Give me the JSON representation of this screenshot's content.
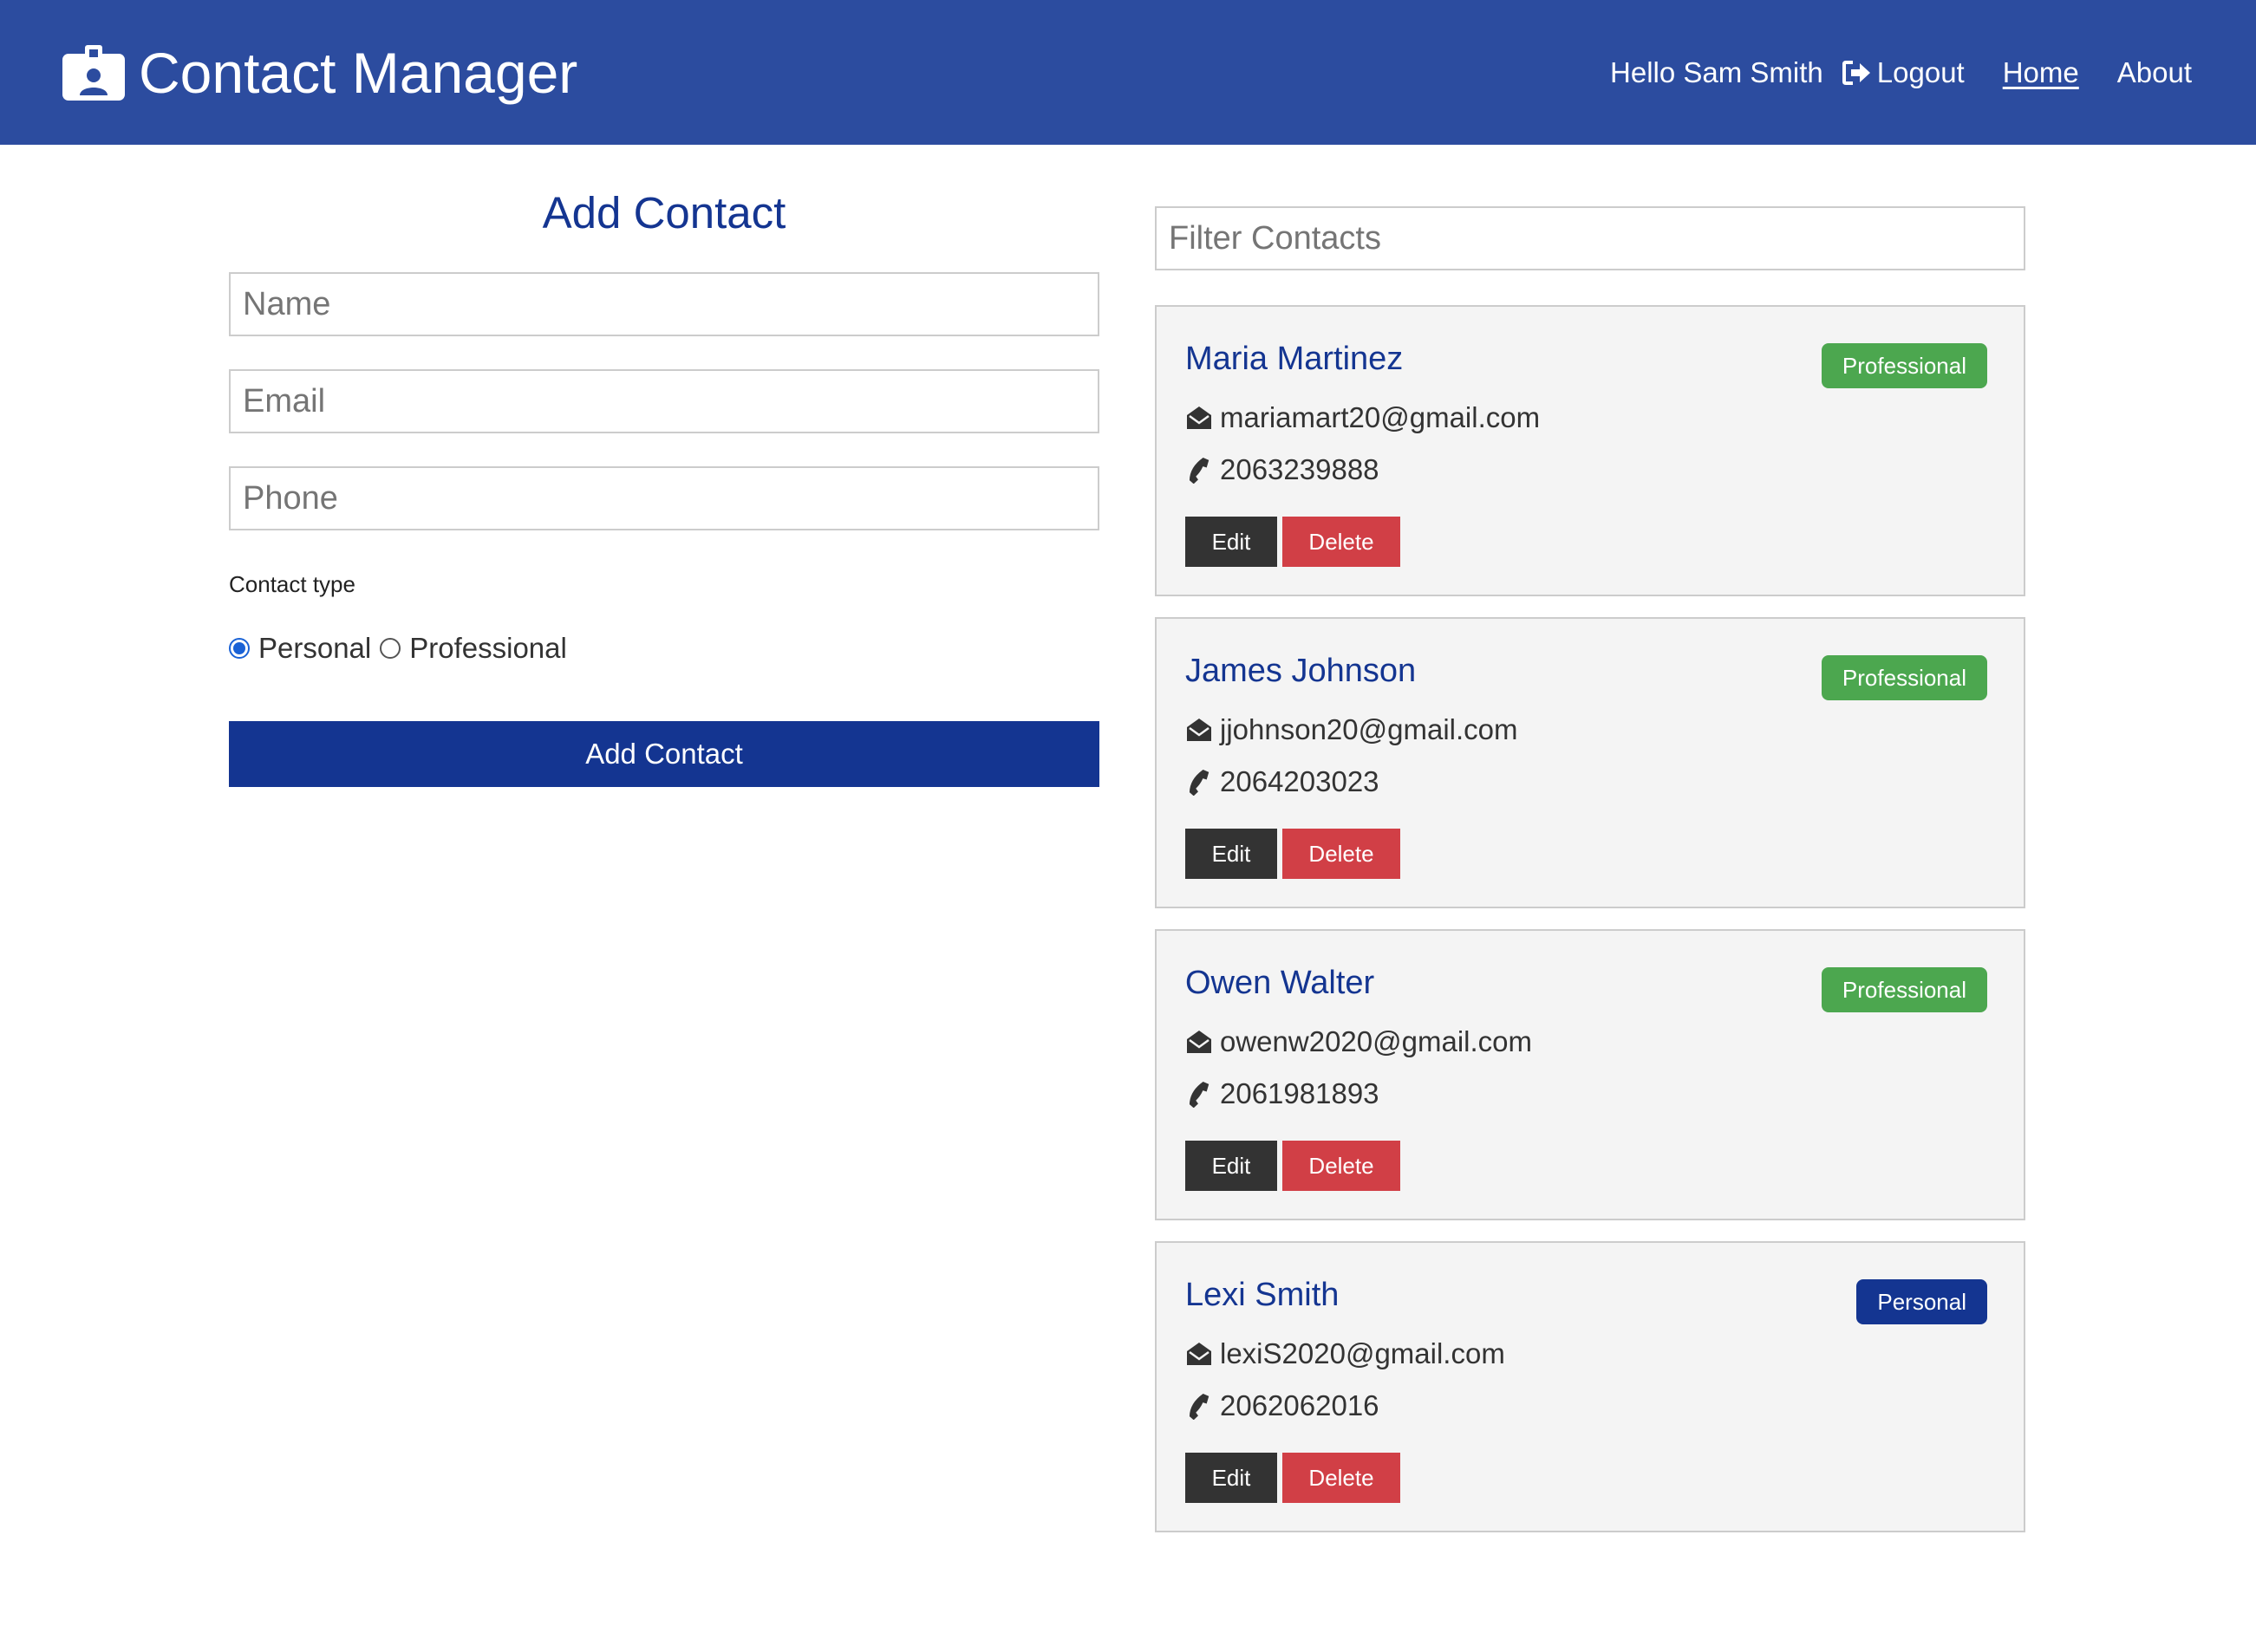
{
  "navbar": {
    "title": "Contact Manager",
    "brand_icon": "id-badge-icon",
    "greeting": "Hello Sam Smith",
    "logout_label": "Logout",
    "logout_icon": "sign-out-icon",
    "links": [
      {
        "label": "Home",
        "active": true
      },
      {
        "label": "About",
        "active": false
      }
    ],
    "background_color": "#2c4c9f"
  },
  "form": {
    "title": "Add Contact",
    "name_placeholder": "Name",
    "email_placeholder": "Email",
    "phone_placeholder": "Phone",
    "name_value": "",
    "email_value": "",
    "phone_value": "",
    "contact_type_label": "Contact type",
    "options": [
      {
        "label": "Personal",
        "checked": true
      },
      {
        "label": "Professional",
        "checked": false
      }
    ],
    "submit_label": "Add Contact",
    "accent_color": "#143591"
  },
  "filter": {
    "placeholder": "Filter Contacts",
    "value": ""
  },
  "contacts": [
    {
      "name": "Maria Martinez",
      "email": "mariamart20@gmail.com",
      "phone": "2063239888",
      "type": "Professional"
    },
    {
      "name": "James Johnson",
      "email": "jjohnson20@gmail.com",
      "phone": "2064203023",
      "type": "Professional"
    },
    {
      "name": "Owen Walter",
      "email": "owenw2020@gmail.com",
      "phone": "2061981893",
      "type": "Professional"
    },
    {
      "name": "Lexi Smith",
      "email": "lexiS2020@gmail.com",
      "phone": "2062062016",
      "type": "Personal"
    }
  ],
  "card_actions": {
    "edit_label": "Edit",
    "delete_label": "Delete"
  },
  "colors": {
    "professional_badge": "#4ca74f",
    "personal_badge": "#143591",
    "delete_button": "#d13f46",
    "edit_button": "#333333"
  },
  "icons": {
    "email": "envelope-open-icon",
    "phone": "phone-icon"
  }
}
